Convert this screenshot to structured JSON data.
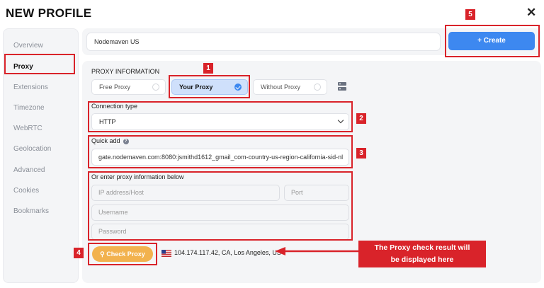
{
  "window": {
    "title": "NEW PROFILE",
    "close_label": "✕"
  },
  "sidebar": {
    "items": [
      {
        "label": "Overview",
        "active": false
      },
      {
        "label": "Proxy",
        "active": true
      },
      {
        "label": "Extensions",
        "active": false
      },
      {
        "label": "Timezone",
        "active": false
      },
      {
        "label": "WebRTC",
        "active": false
      },
      {
        "label": "Geolocation",
        "active": false
      },
      {
        "label": "Advanced",
        "active": false
      },
      {
        "label": "Cookies",
        "active": false
      },
      {
        "label": "Bookmarks",
        "active": false
      }
    ]
  },
  "profile": {
    "name_value": "Nodemaven US"
  },
  "toolbar": {
    "create_label": "+ Create"
  },
  "proxy": {
    "section_label": "PROXY INFORMATION",
    "modes": [
      {
        "label": "Free Proxy",
        "selected": false
      },
      {
        "label": "Your Proxy",
        "selected": true
      },
      {
        "label": "Without Proxy",
        "selected": false
      }
    ],
    "connection_type_label": "Connection type",
    "connection_type_value": "HTTP",
    "quick_add_label": "Quick add",
    "quick_add_value": "gate.nodemaven.com:8080:jsmithd1612_gmail_com-country-us-region-california-sid-nl",
    "manual_label": "Or enter proxy information below",
    "host_placeholder": "IP address/Host",
    "port_placeholder": "Port",
    "username_placeholder": "Username",
    "password_placeholder": "Password",
    "check_button_label": "Check Proxy",
    "check_result": "104.174.117.42, CA, Los Angeles, US"
  },
  "annotations": {
    "callout_line1": "The Proxy check result will",
    "callout_line2": "be displayed here",
    "numbers": [
      "1",
      "2",
      "3",
      "4",
      "5"
    ]
  },
  "colors": {
    "accent": "#3d88f0",
    "check_button": "#f2b24e",
    "annotation": "#d9232a"
  }
}
